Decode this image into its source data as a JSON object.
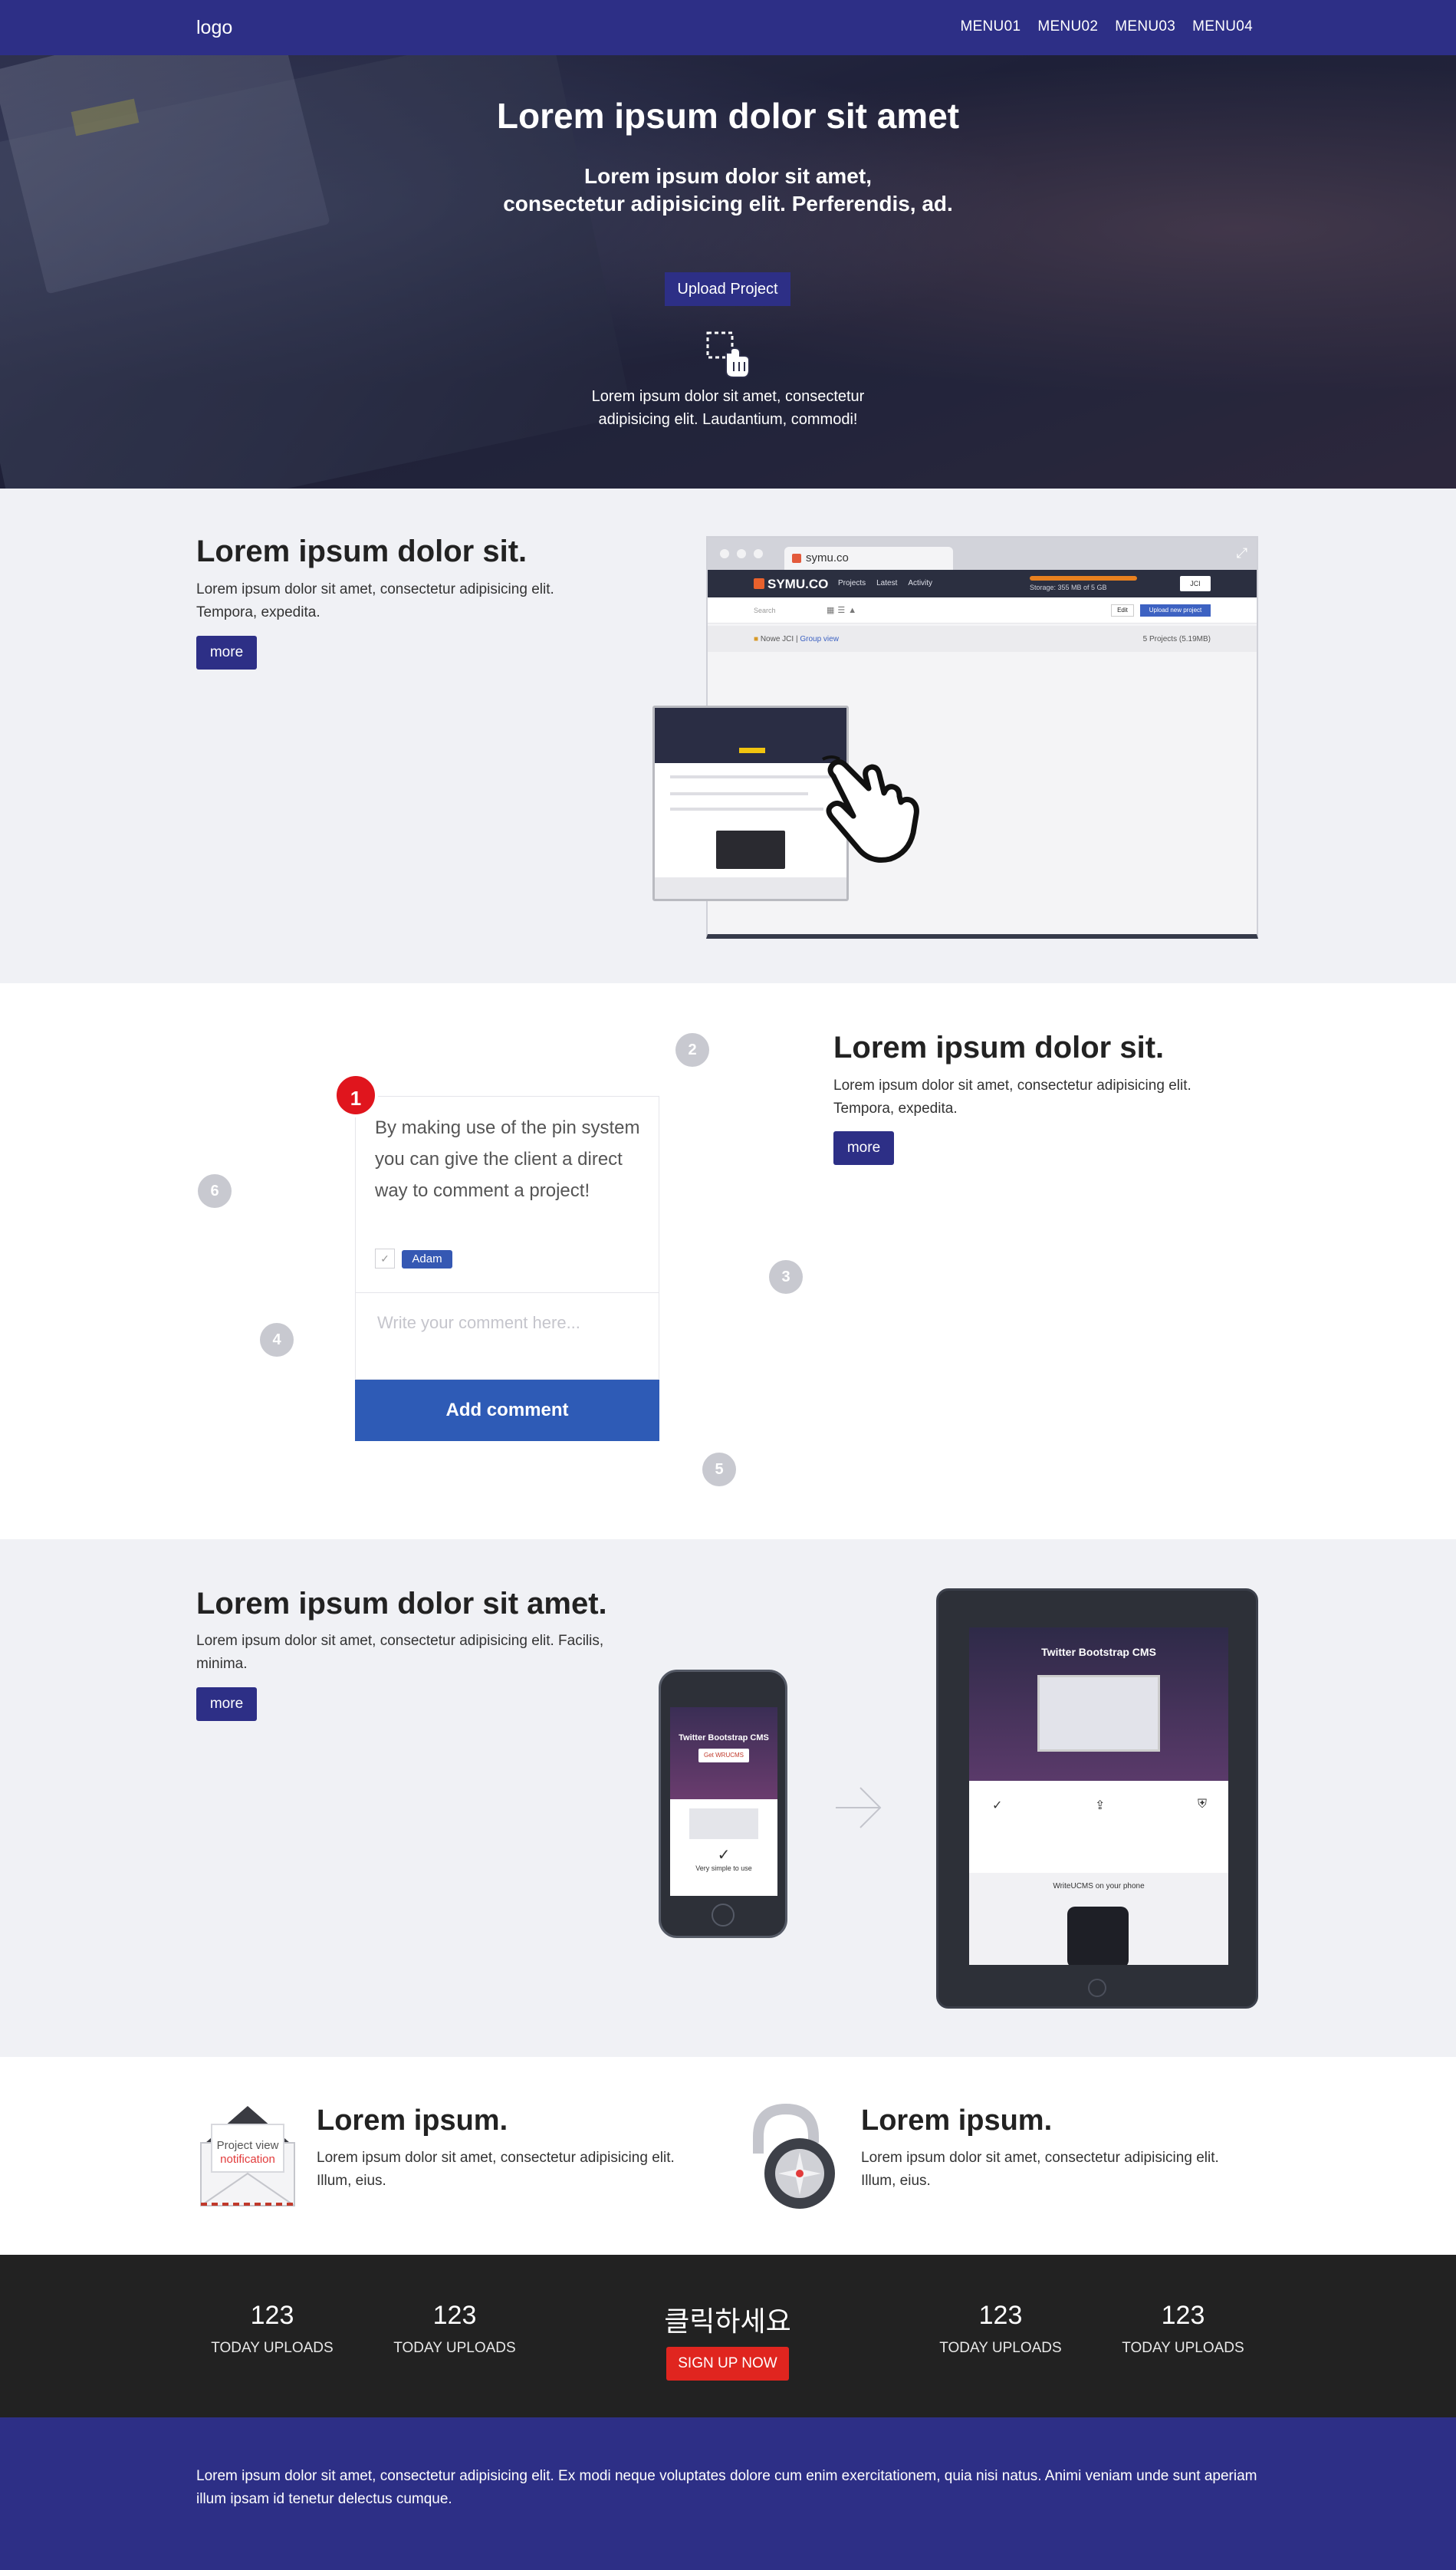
{
  "nav": {
    "logo": "logo",
    "menu": [
      "MENU01",
      "MENU02",
      "MENU03",
      "MENU04"
    ]
  },
  "hero": {
    "title": "Lorem ipsum dolor sit amet",
    "subtitle_line1": "Lorem ipsum dolor sit amet,",
    "subtitle_line2": "consectetur adipisicing elit. Perferendis, ad.",
    "upload_label": "Upload Project",
    "drag_line1": "Lorem ipsum dolor sit amet, consectetur",
    "drag_line2": "adipisicing elit. Laudantium, commodi!",
    "drag_icon": "drag-drop-icon"
  },
  "section1": {
    "title": "Lorem ipsum dolor sit.",
    "desc_line1": "Lorem ipsum dolor sit amet, consectetur adipisicing elit.",
    "desc_line2": "Tempora, expedita.",
    "more_label": "more",
    "browser": {
      "tab_title": "symu.co",
      "brand": "SYMU.CO",
      "nav": [
        "Projects",
        "Latest",
        "Activity"
      ],
      "storage": "Storage: 355 MB of 5 GB",
      "user": "JCI",
      "search": "Search",
      "edit": "Edit",
      "new_project": "Upload new project",
      "crumb_folder": "Nowe JCI",
      "crumb_view": "Group view",
      "count": "5 Projects (5.19MB)"
    },
    "hand_icon": "pointing-hand-icon"
  },
  "section2": {
    "title": "Lorem ipsum dolor sit.",
    "desc_line1": "Lorem ipsum dolor sit amet, consectetur adipisicing elit.",
    "desc_line2": "Tempora, expedita.",
    "more_label": "more",
    "comment": "By making use of the pin system you can give the client a direct way to comment a project!",
    "author": "Adam",
    "placeholder": "Write your comment here...",
    "add_label": "Add comment",
    "pins": [
      "1",
      "2",
      "3",
      "4",
      "5",
      "6"
    ]
  },
  "section3": {
    "title": "Lorem ipsum dolor sit amet.",
    "desc_line1": "Lorem ipsum dolor sit amet, consectetur adipisicing elit. Facilis,",
    "desc_line2": "minima.",
    "more_label": "more",
    "phone_title": "Twitter Bootstrap CMS",
    "phone_btn": "Get WRUCMS",
    "phone_caption": "Very simple to use",
    "tablet_title": "Twitter Bootstrap CMS",
    "tablet_sub": "WriteUCMS on your phone"
  },
  "features": [
    {
      "title": "Lorem ipsum.",
      "desc_line1": "Lorem ipsum dolor sit amet, consectetur adipisicing elit.",
      "desc_line2": "Illum, eius.",
      "icon": "notification-envelope-icon",
      "icon_text1": "Project view",
      "icon_text2": "notification"
    },
    {
      "title": "Lorem ipsum.",
      "desc_line1": "Lorem ipsum dolor sit amet, consectetur adipisicing elit.",
      "desc_line2": "Illum, eius.",
      "icon": "padlock-icon"
    }
  ],
  "stats": [
    {
      "num": "123",
      "label": "TODAY UPLOADS"
    },
    {
      "num": "123",
      "label": "TODAY UPLOADS"
    },
    {
      "num": "123",
      "label": "TODAY UPLOADS"
    },
    {
      "num": "123",
      "label": "TODAY UPLOADS"
    }
  ],
  "cta": {
    "korean": "클릭하세요",
    "signup": "SIGN UP NOW"
  },
  "footer": {
    "text": "Lorem ipsum dolor sit amet, consectetur adipisicing elit. Ex modi neque voluptates dolore cum enim exercitationem, quia nisi natus. Animi veniam unde sunt aperiam illum ipsam id tenetur delectus cumque."
  },
  "colors": {
    "brand": "#2d2f86",
    "button_blue": "#2e5bb6",
    "pin_red": "#e0151d",
    "signup_red": "#e0251f",
    "stats_bg": "#222222",
    "section_gray": "#f0f1f5"
  }
}
